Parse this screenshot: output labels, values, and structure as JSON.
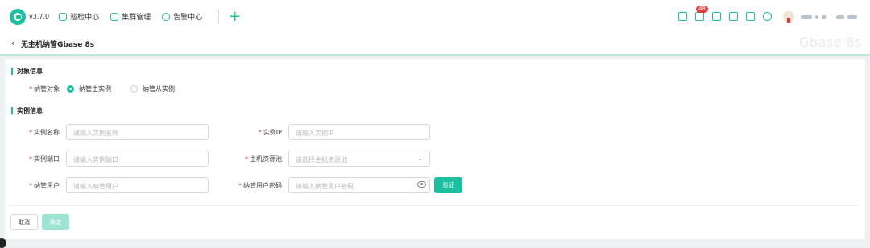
{
  "header": {
    "version": "v3.7.0",
    "nav": [
      {
        "label": "巡检中心",
        "icon": "inspection-icon"
      },
      {
        "label": "集群管理",
        "icon": "cluster-icon"
      },
      {
        "label": "告警中心",
        "icon": "alarm-icon"
      }
    ],
    "add_icon": "plus-icon",
    "notification_count": "48",
    "accent_color": "#1cbf9f"
  },
  "page": {
    "title": "无主机纳管Gbase 8s",
    "watermark": "Gbase 8s"
  },
  "sections": {
    "object_info": "对象信息",
    "instance_info": "实例信息"
  },
  "form": {
    "target_label": "纳管对象",
    "target_options": [
      "纳管主实例",
      "纳管从实例"
    ],
    "target_selected": "纳管主实例",
    "instance_name_label": "实例名称",
    "instance_name_placeholder": "请输入实例名称",
    "instance_ip_label": "实例IP",
    "instance_ip_placeholder": "请输入实例IP",
    "instance_port_label": "实例端口",
    "instance_port_placeholder": "请输入实例端口",
    "host_pool_label": "主机资源池",
    "host_pool_placeholder": "请选择主机资源池",
    "manage_user_label": "纳管用户",
    "manage_user_placeholder": "请输入纳管用户",
    "manage_pwd_label": "纳管用户密码",
    "manage_pwd_placeholder": "请输入纳管用户密码",
    "verify_button": "验证",
    "required_mark": "*"
  },
  "footer": {
    "cancel": "取消",
    "confirm": "确定"
  }
}
